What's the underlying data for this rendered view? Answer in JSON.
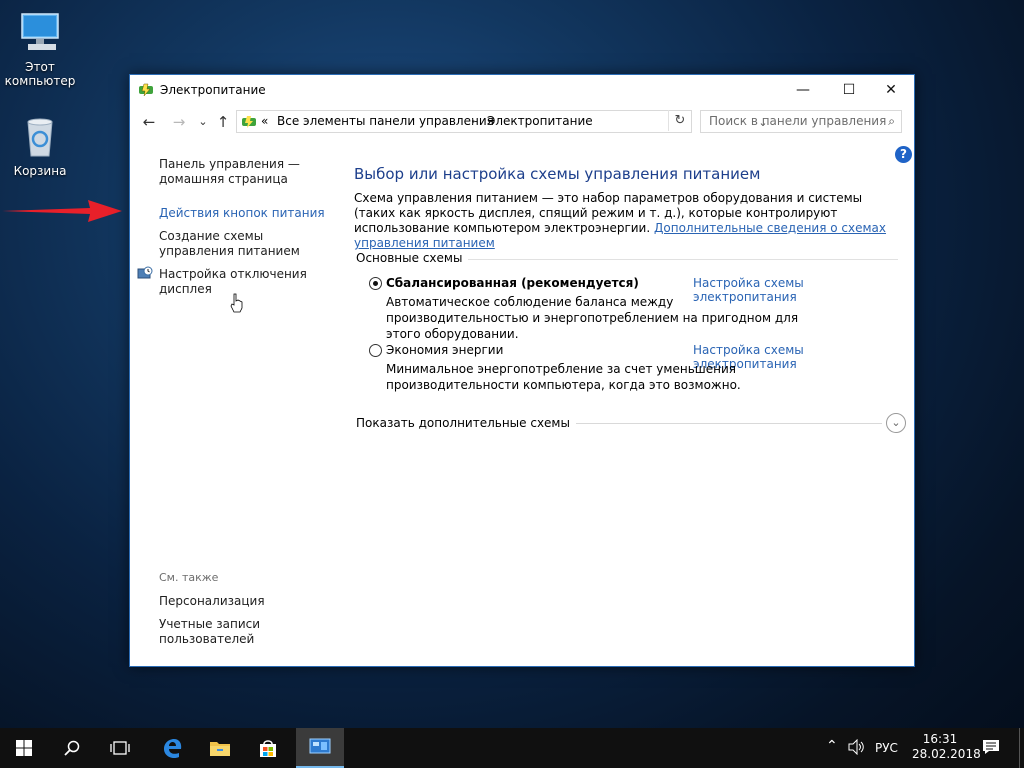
{
  "desktop": {
    "icons": [
      {
        "label": "Этот\nкомпьютер",
        "icon": "computer-icon"
      },
      {
        "label": "Корзина",
        "icon": "recycle-bin-icon"
      }
    ]
  },
  "window": {
    "title": "Электропитание",
    "icon": "power-options-icon",
    "controls": {
      "minimize": "—",
      "maximize": "☐",
      "close": "✕"
    }
  },
  "nav": {
    "back": "←",
    "forward": "→",
    "recent": "⌄",
    "up": "↑",
    "breadcrumb_prefix": "«",
    "breadcrumb": [
      "Все элементы панели управления",
      "Электропитание"
    ],
    "separator": "›",
    "search_placeholder": "Поиск в панели управления"
  },
  "sidebar": {
    "items": [
      {
        "label": "Панель управления — домашняя страница"
      },
      {
        "label": "Действия кнопок питания"
      },
      {
        "label": "Создание схемы управления питанием"
      },
      {
        "label": "Настройка отключения дисплея"
      }
    ],
    "see_also_title": "См. также",
    "see_also": [
      {
        "label": "Персонализация"
      },
      {
        "label": "Учетные записи пользователей"
      }
    ]
  },
  "main": {
    "heading": "Выбор или настройка схемы управления питанием",
    "description": "Схема управления питанием — это набор параметров оборудования и системы (таких как яркость дисплея, спящий режим и т. д.), которые контролируют использование компьютером электроэнергии.",
    "description_link": "Дополнительные сведения о схемах управления питанием",
    "group_label": "Основные схемы",
    "plans": [
      {
        "name": "Сбалансированная (рекомендуется)",
        "selected": true,
        "link": "Настройка схемы электропитания",
        "description": "Автоматическое соблюдение баланса между производительностью и энергопотреблением на пригодном для этого оборудовании."
      },
      {
        "name": "Экономия энергии",
        "selected": false,
        "link": "Настройка схемы электропитания",
        "description": "Минимальное энергопотребление за счет уменьшения производительности компьютера, когда это возможно."
      }
    ],
    "show_more": "Показать дополнительные схемы",
    "help": "?"
  },
  "taskbar": {
    "language": "РУС",
    "time": "16:31",
    "date": "28.02.2018"
  },
  "colors": {
    "link": "#2a64b4",
    "heading": "#1d3f8c",
    "arrow": "#e8202a",
    "taskbar": "#101010"
  }
}
